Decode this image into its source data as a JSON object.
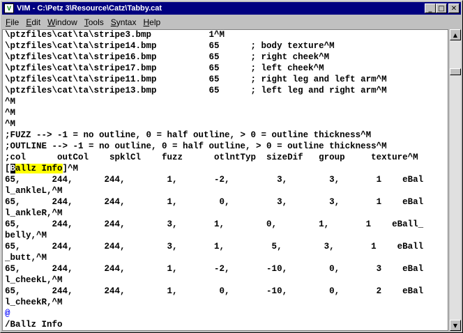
{
  "window": {
    "title": "VIM - C:\\Petz 3\\Resource\\Catz\\Tabby.cat",
    "app_icon_glyph": "V",
    "minimize_glyph": "_",
    "maximize_glyph": "□",
    "close_glyph": "✕"
  },
  "menu": [
    {
      "underline": "F",
      "rest": "ile"
    },
    {
      "underline": "E",
      "rest": "dit"
    },
    {
      "underline": "W",
      "rest": "indow"
    },
    {
      "underline": "T",
      "rest": "ools"
    },
    {
      "underline": "S",
      "rest": "yntax"
    },
    {
      "underline": "H",
      "rest": "elp"
    }
  ],
  "editor": {
    "lines": [
      "\\ptzfiles\\cat\\ta\\stripe3.bmp           1^M",
      "\\ptzfiles\\cat\\ta\\stripe14.bmp          65      ; body texture^M",
      "\\ptzfiles\\cat\\ta\\stripe16.bmp          65      ; right cheek^M",
      "\\ptzfiles\\cat\\ta\\stripe17.bmp          65      ; left cheek^M",
      "\\ptzfiles\\cat\\ta\\stripe11.bmp          65      ; right leg and left arm^M",
      "\\ptzfiles\\cat\\ta\\stripe13.bmp          65      ; left leg and right arm^M",
      "^M",
      "^M",
      "^M",
      ";FUZZ --> -1 = no outline, 0 = half outline, > 0 = outline thickness^M",
      ";OUTLINE --> -1 = no outline, 0 = half outline, > 0 = outline thickness^M",
      ";col      outCol    spklCl    fuzz      otlntTyp  sizeDif   group     texture^M",
      null,
      "65,      244,      244,        1,       -2,         3,        3,       1    eBal",
      "l_ankleL,^M",
      "65,      244,      244,        1,        0,         3,        3,       1    eBal",
      "l_ankleR,^M",
      "65,      244,      244,        3,       1,        0,        1,       1    eBall_",
      "belly,^M",
      "65,      244,      244,        3,       1,         5,        3,       1    eBall",
      "_butt,^M",
      "65,      244,      244,        1,       -2,       -10,        0,       3    eBal",
      "l_cheekL,^M",
      "65,      244,      244,        1,        0,       -10,        0,       2    eBal",
      "l_cheekR,^M",
      "@",
      "/Ballz Info"
    ],
    "section_open": "[",
    "cursor_char": "B",
    "section_highlight": "allz Info",
    "section_close": "]^M"
  }
}
